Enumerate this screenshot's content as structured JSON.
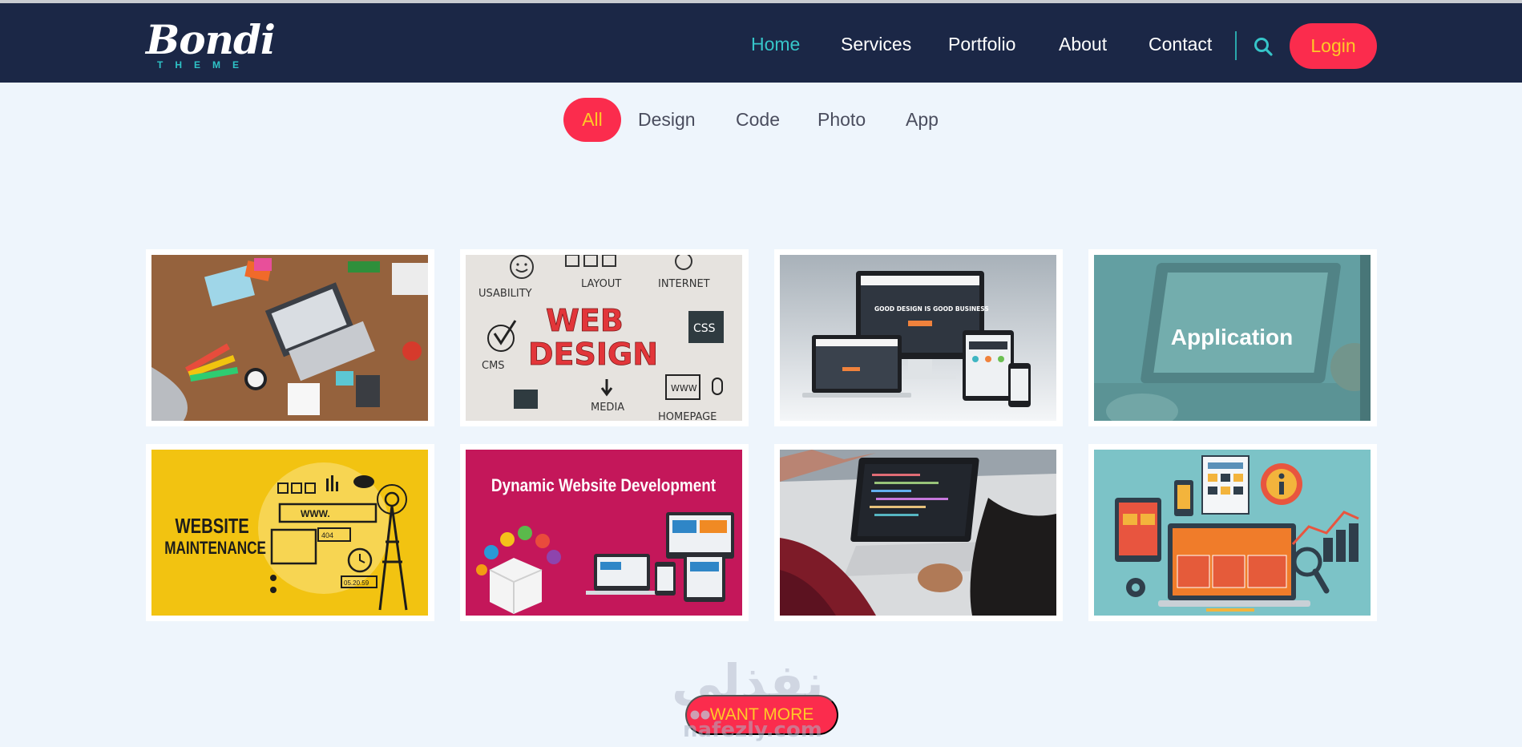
{
  "brand": {
    "script": "Bondi",
    "sub": "THEME"
  },
  "nav": {
    "items": [
      {
        "label": "Home",
        "active": true
      },
      {
        "label": "Services"
      },
      {
        "label": "Portfolio"
      },
      {
        "label": "About"
      },
      {
        "label": "Contact"
      }
    ],
    "search_icon": "search-icon",
    "login_label": "Login"
  },
  "filters": [
    "All",
    "Design",
    "Code",
    "Photo",
    "App"
  ],
  "portfolio": {
    "cards": [
      {
        "caption": ""
      },
      {
        "words": [
          "USABILITY",
          "LAYOUT",
          "INTERNET",
          "WEB",
          "DESIGN",
          "CSS",
          "CMS",
          "MEDIA",
          "WWW",
          "HOMEPAGE"
        ]
      },
      {
        "headline": "GOOD DESIGN IS GOOD BUSINESS"
      },
      {
        "overlay": "Application"
      },
      {
        "line1": "WEBSITE",
        "line2": "MAINTENANCE",
        "url": "WWW.",
        "code": "404",
        "date": "05.20.59"
      },
      {
        "title": "Dynamic Website Development"
      },
      {
        "caption": ""
      },
      {
        "caption": ""
      }
    ]
  },
  "cta": {
    "label": "WANT MORE"
  },
  "watermark": {
    "arabic": "نفذلي",
    "latin": "nafezly.com"
  },
  "colors": {
    "navy": "#1b2746",
    "accent": "#fb2c4d",
    "accent_text": "#ffc927",
    "teal": "#36c5c9",
    "page_bg": "#eef5fc"
  }
}
